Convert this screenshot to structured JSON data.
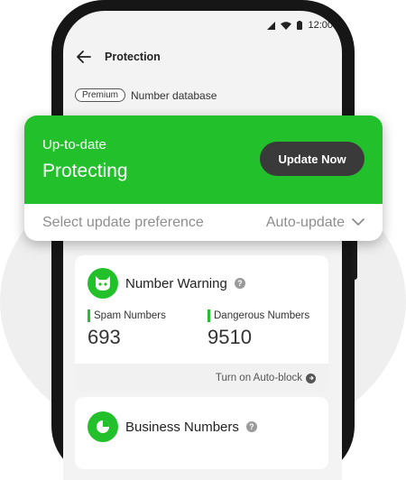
{
  "status_bar": {
    "time": "12:00"
  },
  "header": {
    "title": "Protection"
  },
  "database": {
    "badge": "Premium",
    "label": "Number database"
  },
  "protection_card": {
    "status_subtitle": "Up-to-date",
    "status_title": "Protecting",
    "update_button": "Update Now",
    "preference_label": "Select update preference",
    "preference_value": "Auto-update"
  },
  "number_warning": {
    "title": "Number Warning",
    "spam_label": "Spam Numbers",
    "spam_count": "693",
    "dangerous_label": "Dangerous Numbers",
    "dangerous_count": "9510",
    "auto_block_label": "Turn on Auto-block"
  },
  "business_numbers": {
    "title": "Business Numbers"
  },
  "colors": {
    "accent": "#22c02b",
    "button": "#3a3a3a"
  },
  "icons": [
    "signal-icon",
    "wifi-icon",
    "battery-icon",
    "back-arrow-icon",
    "chevron-down-icon",
    "cat-shield-icon",
    "help-icon",
    "arrow-right-circle-icon",
    "business-icon"
  ]
}
